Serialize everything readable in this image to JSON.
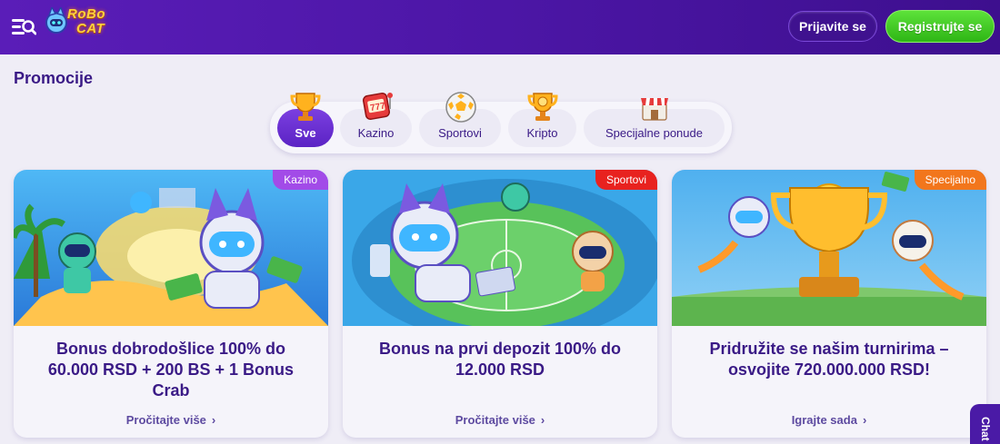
{
  "header": {
    "logo_line1": "RoBo",
    "logo_line2": "CAT",
    "login_label": "Prijavite se",
    "register_label": "Registrujte se"
  },
  "page_title": "Promocije",
  "tabs": [
    {
      "label": "Sve",
      "icon": "trophy-icon",
      "active": true
    },
    {
      "label": "Kazino",
      "icon": "slot-machine-icon",
      "active": false
    },
    {
      "label": "Sportovi",
      "icon": "soccer-ball-icon",
      "active": false
    },
    {
      "label": "Kripto",
      "icon": "crypto-trophy-icon",
      "active": false
    },
    {
      "label": "Specijalne ponude",
      "icon": "gift-shop-icon",
      "active": false
    }
  ],
  "cards": [
    {
      "badge": "Kazino",
      "badge_color": "#a24be8",
      "title": "Bonus dobrodošlice 100% do 60.000 RSD + 200 BS + 1 Bonus Crab",
      "link": "Pročitajte više"
    },
    {
      "badge": "Sportovi",
      "badge_color": "#e8221f",
      "title": "Bonus na prvi depozit 100% do 12.000 RSD",
      "link": "Pročitajte više"
    },
    {
      "badge": "Specijalno",
      "badge_color": "#f2761c",
      "title": "Pridružite se našim turnirima – osvojite 720.000.000 RSD!",
      "link": "Igrajte sada"
    }
  ],
  "chat_label": "Chat",
  "colors": {
    "header": "#4c16a6",
    "accent": "#5b23c4",
    "register": "#2eb515",
    "title": "#3a1a86"
  }
}
